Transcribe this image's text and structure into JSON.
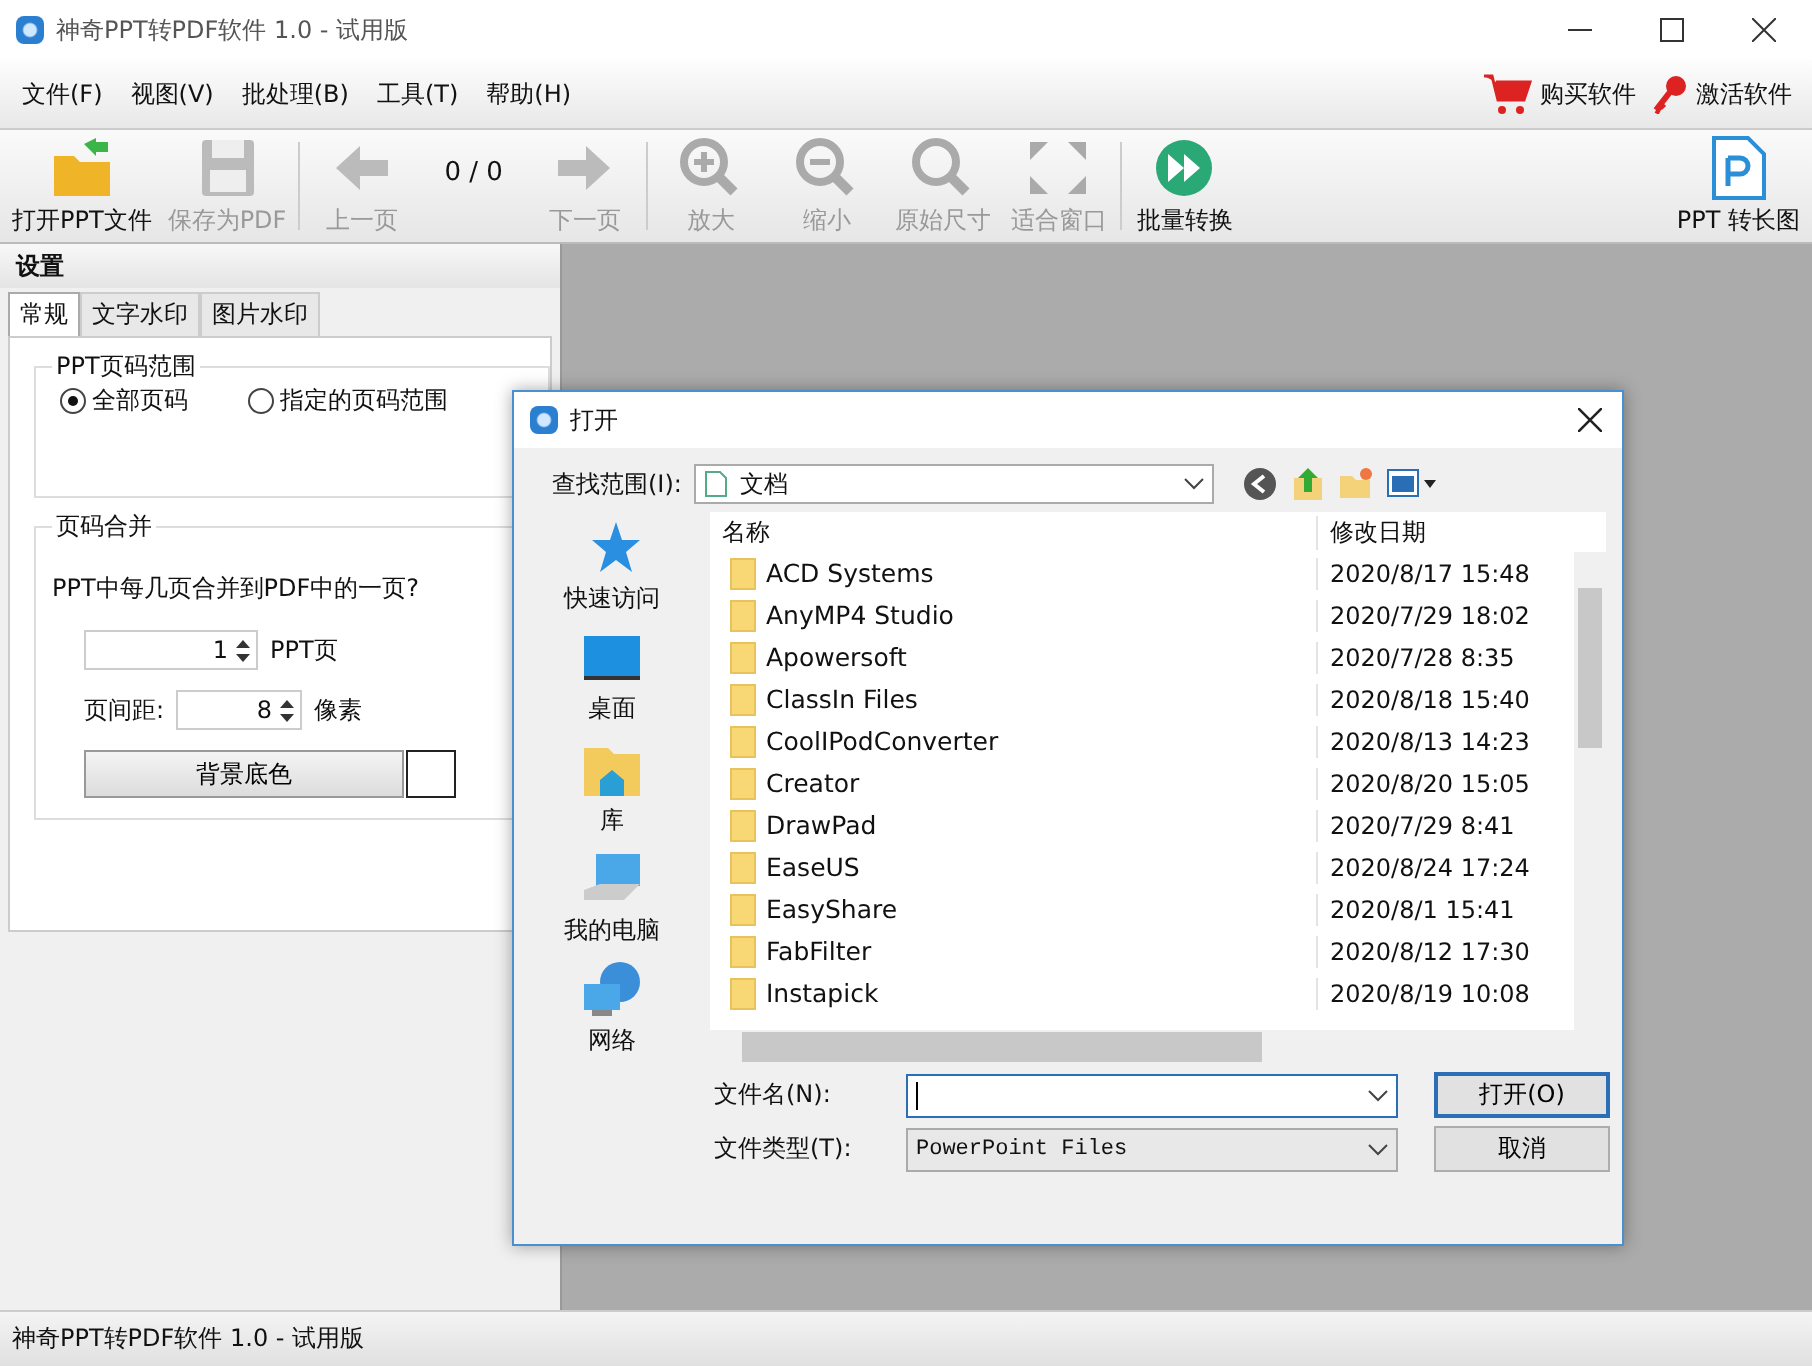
{
  "window": {
    "title": "神奇PPT转PDF软件 1.0 - 试用版"
  },
  "menu": [
    "文件(F)",
    "视图(V)",
    "批处理(B)",
    "工具(T)",
    "帮助(H)"
  ],
  "menu_actions": [
    {
      "label": "购买软件"
    },
    {
      "label": "激活软件"
    }
  ],
  "toolbar": [
    {
      "label": "打开PPT文件",
      "disabled": false
    },
    {
      "label": "保存为PDF",
      "disabled": true
    },
    {
      "label": "上一页",
      "disabled": true
    },
    {
      "label": "0 / 0",
      "kind": "counter"
    },
    {
      "label": "下一页",
      "disabled": true
    },
    {
      "label": "放大",
      "disabled": true
    },
    {
      "label": "缩小",
      "disabled": true
    },
    {
      "label": "原始尺寸",
      "disabled": true
    },
    {
      "label": "适合窗口",
      "disabled": true
    },
    {
      "label": "批量转换",
      "disabled": false
    }
  ],
  "toolbar_right": {
    "label": "PPT 转长图"
  },
  "settings": {
    "title": "设置",
    "tabs": [
      {
        "label": "常规",
        "selected": true
      },
      {
        "label": "文字水印",
        "selected": false
      },
      {
        "label": "图片水印",
        "selected": false
      }
    ],
    "page_range": {
      "title": "PPT页码范围",
      "options": [
        {
          "label": "全部页码",
          "selected": true
        },
        {
          "label": "指定的页码范围",
          "selected": false
        }
      ]
    },
    "merge": {
      "title": "页码合并",
      "question": "PPT中每几页合并到PDF中的一页?",
      "pages_value": "1",
      "pages_unit": "PPT页",
      "gap_label": "页间距:",
      "gap_value": "8",
      "gap_unit": "像素",
      "bg_button": "背景底色"
    }
  },
  "dialog": {
    "title": "打开",
    "look_in_label": "查找范围(I):",
    "look_in_value": "文档",
    "places": [
      "快速访问",
      "桌面",
      "库",
      "我的电脑",
      "网络"
    ],
    "columns": [
      "名称",
      "修改日期"
    ],
    "rows": [
      {
        "name": "ACD Systems",
        "date": "2020/8/17 15:48"
      },
      {
        "name": "AnyMP4 Studio",
        "date": "2020/7/29 18:02"
      },
      {
        "name": "Apowersoft",
        "date": "2020/7/28 8:35"
      },
      {
        "name": "ClassIn Files",
        "date": "2020/8/18 15:40"
      },
      {
        "name": "CoolIPodConverter",
        "date": "2020/8/13 14:23"
      },
      {
        "name": "Creator",
        "date": "2020/8/20 15:05"
      },
      {
        "name": "DrawPad",
        "date": "2020/7/29 8:41"
      },
      {
        "name": "EaseUS",
        "date": "2020/8/24 17:24"
      },
      {
        "name": "EasyShare",
        "date": "2020/8/1 15:41"
      },
      {
        "name": "FabFilter",
        "date": "2020/8/12 17:30"
      },
      {
        "name": "Instapick",
        "date": "2020/8/19 10:08"
      }
    ],
    "filename_label": "文件名(N):",
    "filetype_label": "文件类型(T):",
    "filetype_value": "PowerPoint Files",
    "buttons": [
      "打开(O)",
      "取消"
    ]
  },
  "status_bar": "神奇PPT转PDF软件 1.0 - 试用版"
}
